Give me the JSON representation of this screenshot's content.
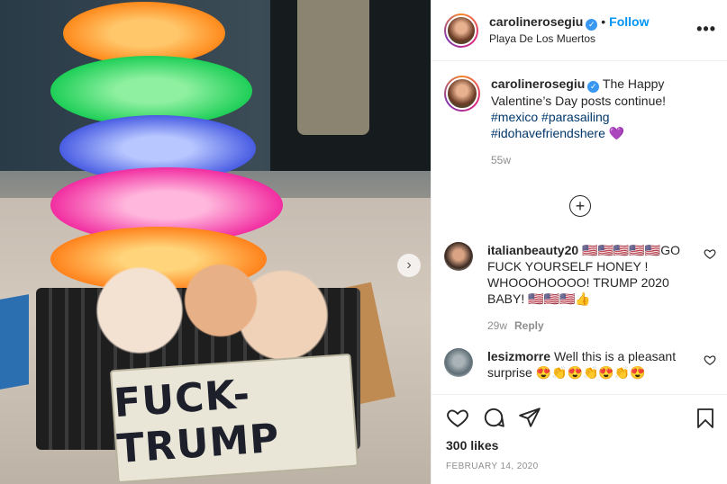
{
  "post": {
    "author": "carolinerosegiu",
    "follow_label": "Follow",
    "separator": "•",
    "location": "Playa De Los Muertos",
    "more_label": "•••",
    "next_arrow": "›"
  },
  "photo": {
    "sign_text": "FUCK-TRUMP"
  },
  "caption": {
    "username": "carolinerosegiu",
    "text": "The Happy Valentine’s Day posts continue!",
    "hashtags": [
      "#mexico",
      "#parasailing",
      "#idohavefriendshere"
    ],
    "emoji": "💜",
    "time": "55w"
  },
  "load_more_label": "+",
  "comments": [
    {
      "username": "italianbeauty20",
      "text": "🇺🇸🇺🇸🇺🇸🇺🇸🇺🇸GO FUCK YOURSELF HONEY ! WHOOOHOOOO! TRUMP 2020 BABY! 🇺🇸🇺🇸🇺🇸👍",
      "time": "29w",
      "reply_label": "Reply"
    },
    {
      "username": "lesizmorre",
      "text": "Well this is a pleasant surprise 😍👏😍👏😍👏😍",
      "time": "",
      "reply_label": ""
    }
  ],
  "footer": {
    "likes": "300 likes",
    "date": "FEBRUARY 14, 2020"
  },
  "icons": [
    "heart-icon",
    "comment-icon",
    "share-icon",
    "bookmark-icon",
    "verified-icon",
    "add-comments-icon",
    "chevron-right-icon"
  ]
}
